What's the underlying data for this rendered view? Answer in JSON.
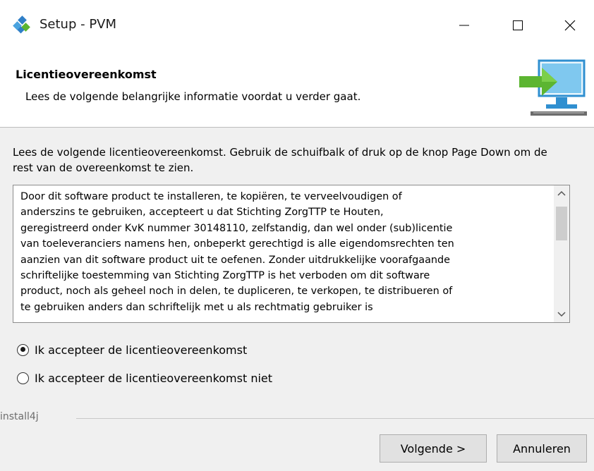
{
  "window": {
    "title": "Setup - PVM",
    "icons": {
      "app": "setup-wizard-icon",
      "minimize": "minimize-icon",
      "maximize": "maximize-icon",
      "close": "close-icon"
    }
  },
  "header": {
    "title": "Licentieovereenkomst",
    "subtitle": "Lees de volgende belangrijke informatie voordat u verder gaat.",
    "image": "monitor-arrow-icon"
  },
  "intro": "Lees de volgende licentieovereenkomst. Gebruik de schuifbalk of druk op de knop Page Down om de rest van de overeenkomst te zien.",
  "license": {
    "text": "Door dit software product te installeren, te kopiëren, te verveelvoudigen of\nanderszins te gebruiken, accepteert u dat  Stichting ZorgTTP te Houten,\ngeregistreerd onder KvK nummer 30148110,  zelfstandig, dan wel onder (sub)licentie\nvan toeleveranciers namens hen, onbeperkt gerechtigd is alle eigendomsrechten ten\naanzien van dit software product uit te oefenen. Zonder uitdrukkelijke voorafgaande\nschriftelijke toestemming van Stichting ZorgTTP is het verboden om dit software\nproduct, noch als geheel noch in delen, te dupliceren, te verkopen, te distribueren of\nte gebruiken anders dan schriftelijk met u als rechtmatig gebruiker is",
    "scroll_icons": {
      "up": "chevron-up-icon",
      "down": "chevron-down-icon"
    }
  },
  "options": [
    {
      "label": "Ik accepteer de licentieovereenkomst",
      "selected": true
    },
    {
      "label": "Ik accepteer de licentieovereenkomst niet",
      "selected": false
    }
  ],
  "footer": {
    "brand": "install4j",
    "next_label": "Volgende >",
    "cancel_label": "Annuleren"
  },
  "colors": {
    "accent_green": "#5cb531",
    "accent_blue": "#3a9bd8",
    "background": "#f0f0f0"
  }
}
